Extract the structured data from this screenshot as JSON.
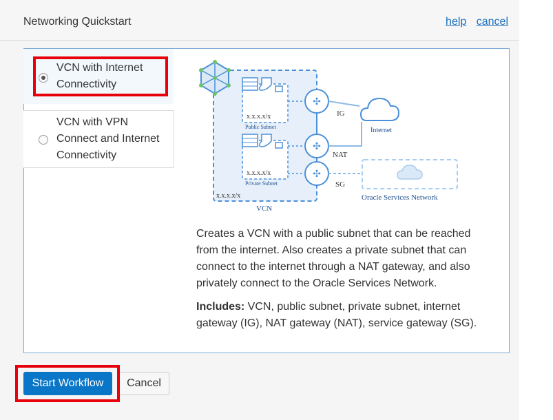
{
  "header": {
    "title": "Networking Quickstart",
    "help_label": "help",
    "cancel_label": "cancel"
  },
  "options": [
    {
      "label_line1": "VCN with Internet",
      "label_line2": "Connectivity",
      "selected": true
    },
    {
      "label_line1": "VCN with VPN",
      "label_line2": "Connect and Internet",
      "label_line3": "Connectivity",
      "selected": false
    }
  ],
  "diagram": {
    "public_subnet": "Public Subnet",
    "private_subnet": "Private Subnet",
    "cidr": "x.x.x.x/x",
    "vcn": "VCN",
    "ig": "IG",
    "nat": "NAT",
    "sg": "SG",
    "internet": "Internet",
    "osn": "Oracle Services Network"
  },
  "description": "Creates a VCN with a public subnet that can be reached from the internet. Also creates a private subnet that can connect to the internet through a NAT gateway, and also privately connect to the Oracle Services Network.",
  "includes_label": "Includes:",
  "includes_text": " VCN, public subnet, private subnet, internet gateway (IG), NAT gateway (NAT), service gateway (SG).",
  "footer": {
    "start_label": "Start Workflow",
    "cancel_label": "Cancel"
  },
  "colors": {
    "accent": "#0a76c8",
    "highlight": "#e8000b",
    "diagram_blue": "#5b9bd5"
  }
}
